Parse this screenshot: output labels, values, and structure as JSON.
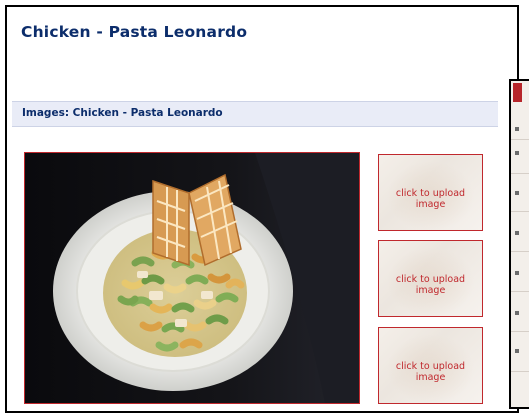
{
  "page": {
    "title": "Chicken - Pasta Leonardo"
  },
  "images_section": {
    "header": "Images: Chicken - Pasta Leonardo",
    "main_image_alt": "pasta-with-chicken-photo"
  },
  "upload_slots": [
    {
      "label": "click to upload image"
    },
    {
      "label": "click to upload image"
    },
    {
      "label": "click to upload image"
    }
  ],
  "colors": {
    "title": "#0c2d6b",
    "accent_border": "#c0282d",
    "header_bg": "#e9ecf7",
    "upload_text": "#c0282d"
  }
}
